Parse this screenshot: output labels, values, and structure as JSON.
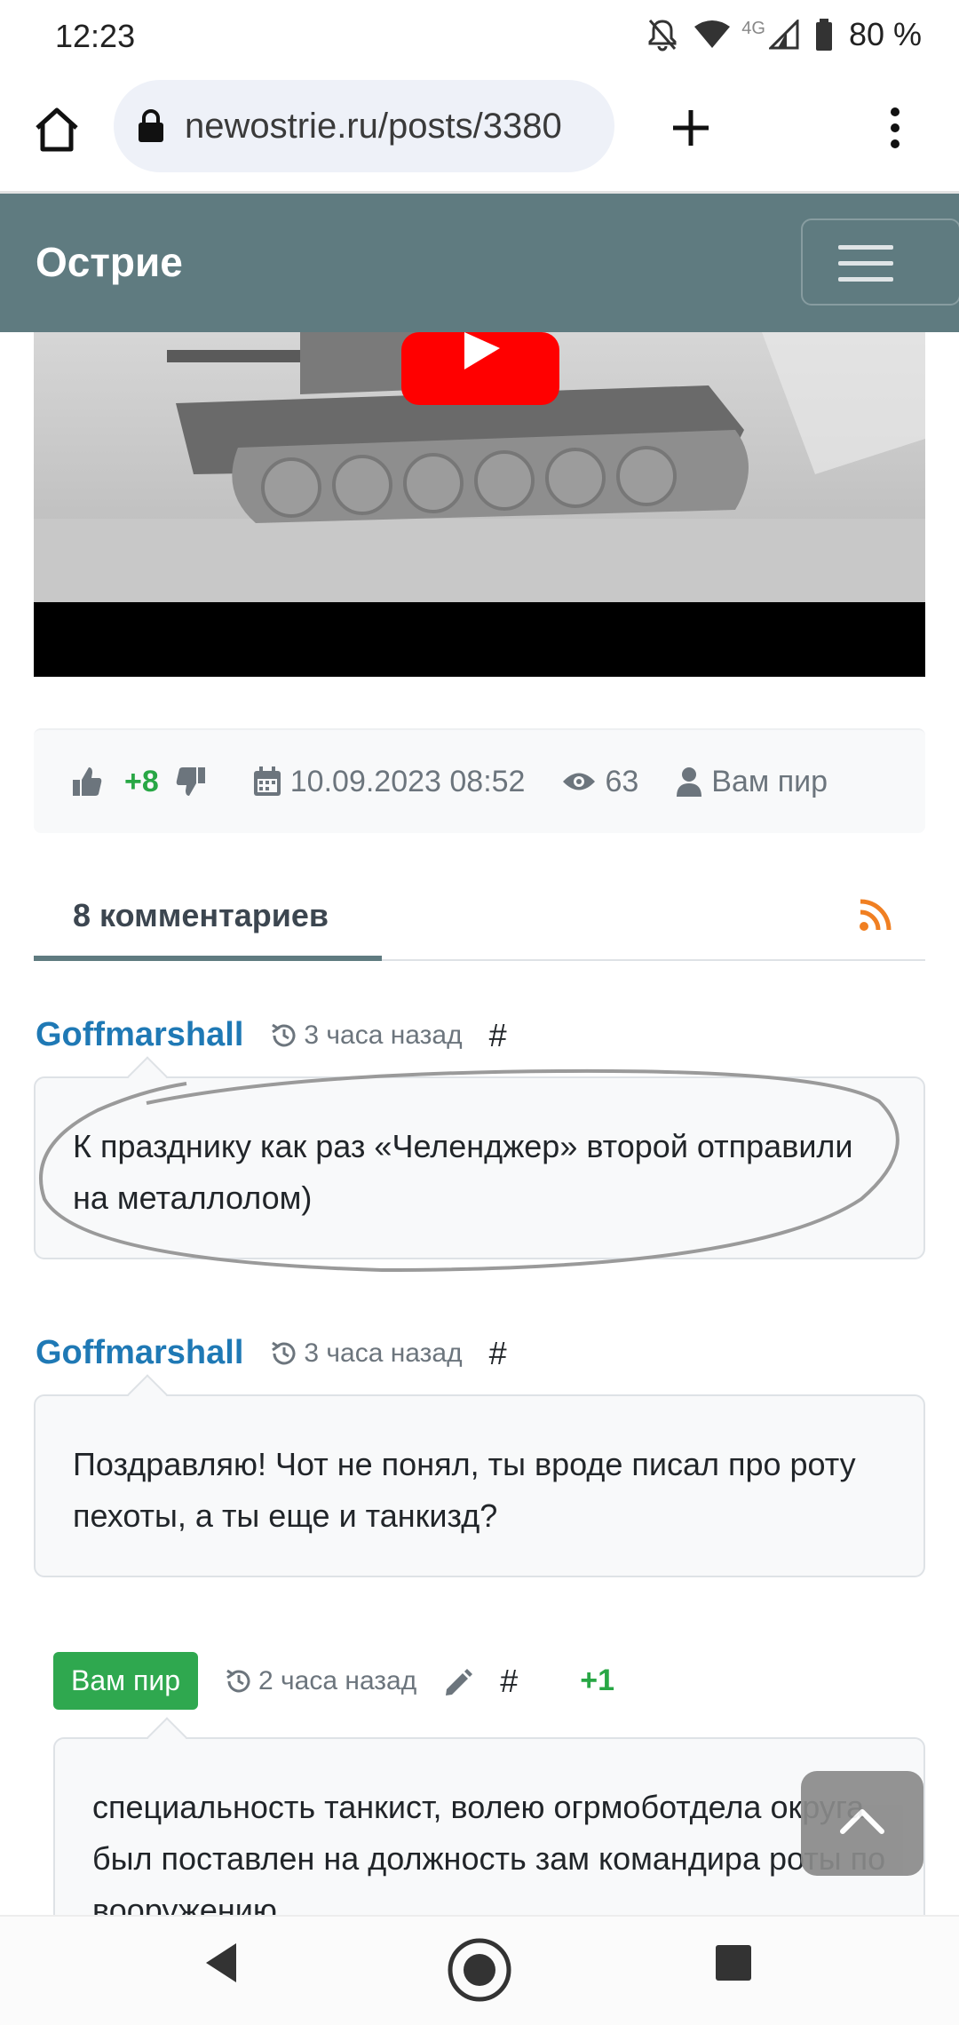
{
  "status_bar": {
    "time": "12:23",
    "network": "4G",
    "battery": "80 %"
  },
  "browser": {
    "url": "newostrie.ru/posts/3380"
  },
  "site": {
    "brand": "Острие"
  },
  "post_meta": {
    "score": "+8",
    "date": "10.09.2023 08:52",
    "views": "63",
    "author": "Вам пир"
  },
  "comments_tab": {
    "label": "8 комментариев"
  },
  "comments": [
    {
      "author": "Goffmarshall",
      "time": "3 часа назад",
      "anchor": "#",
      "text": "К празднику как раз «Челенджер» второй отправили на металлолом)"
    },
    {
      "author": "Goffmarshall",
      "time": "3 часа назад",
      "anchor": "#",
      "text": "Поздравляю! Чот не понял, ты вроде писал про роту пехоты, а ты еще и танкизд?"
    },
    {
      "author": "Вам пир",
      "time": "2 часа назад",
      "anchor": "#",
      "vote": "+1",
      "text": "специальность танкист, волею огрмоботдела округа был поставлен на должность зам командира роты по вооружению"
    }
  ],
  "colors": {
    "navbar": "#5f7b80",
    "link": "#1f79b5",
    "success": "#28a745"
  }
}
